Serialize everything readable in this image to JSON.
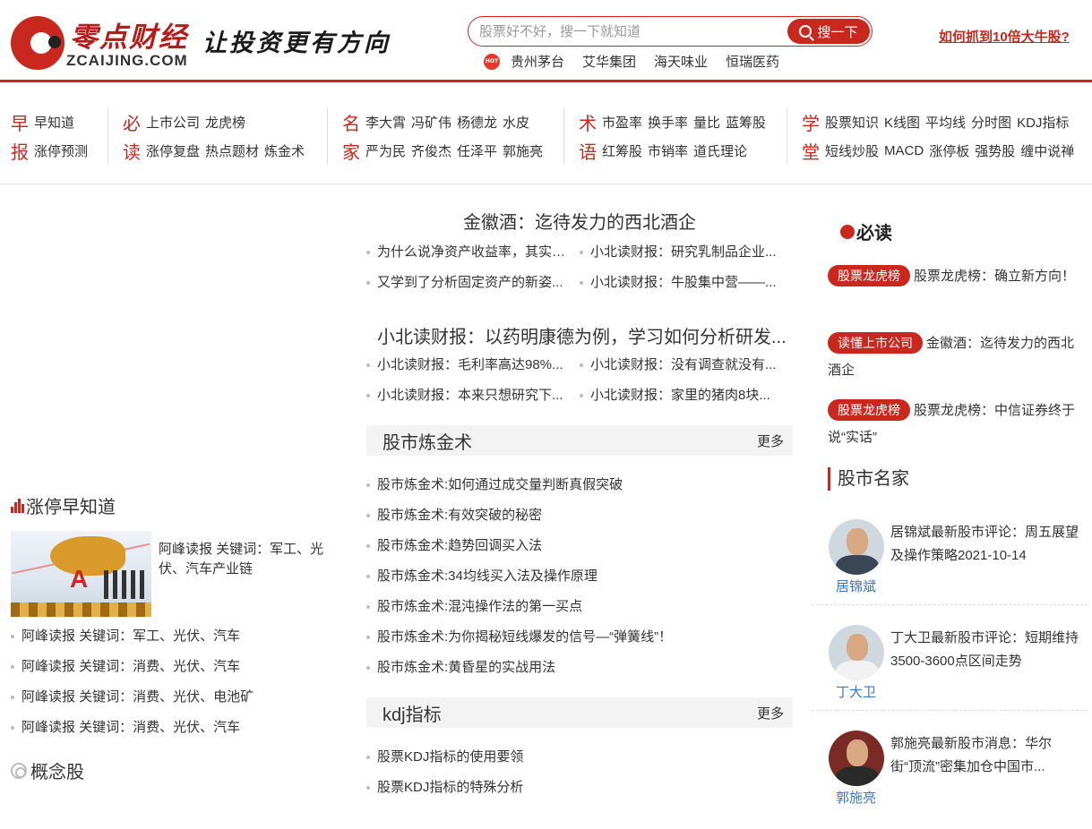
{
  "header": {
    "logo_cn": "零点财经",
    "logo_en": "ZCAIJING.COM",
    "slogan": "让投资更有方向",
    "search_placeholder": "股票好不好，搜一下就知道",
    "search_button": "搜一下",
    "hot_badge": "HOT",
    "hot_links": [
      "贵州茅台",
      "艾华集团",
      "海天味业",
      "恒瑞医药"
    ],
    "promo_link": "如何抓到10倍大牛股?"
  },
  "nav": [
    {
      "chars": [
        "早",
        "报"
      ],
      "rows": [
        [
          "早知道"
        ],
        [
          "涨停预测"
        ]
      ]
    },
    {
      "chars": [
        "必",
        "读"
      ],
      "rows": [
        [
          "上市公司",
          "龙虎榜"
        ],
        [
          "涨停复盘",
          "热点题材",
          "炼金术"
        ]
      ]
    },
    {
      "chars": [
        "名",
        "家"
      ],
      "rows": [
        [
          "李大霄",
          "冯矿伟",
          "杨德龙",
          "水皮"
        ],
        [
          "严为民",
          "齐俊杰",
          "任泽平",
          "郭施亮"
        ]
      ]
    },
    {
      "chars": [
        "术",
        "语"
      ],
      "rows": [
        [
          "市盈率",
          "换手率",
          "量比",
          "蓝筹股"
        ],
        [
          "红筹股",
          "市销率",
          "道氏理论"
        ]
      ]
    },
    {
      "chars": [
        "学",
        "堂"
      ],
      "rows": [
        [
          "股票知识",
          "K线图",
          "平均线",
          "分时图",
          "KDJ指标"
        ],
        [
          "短线炒股",
          "MACD",
          "涨停板",
          "强势股",
          "缠中说禅"
        ]
      ]
    }
  ],
  "left": {
    "limit_title": "涨停早知道",
    "feature_text": "阿峰读报 关键词：军工、光伏、汽车产业链",
    "list": [
      "阿峰读报 关键词：军工、光伏、汽车",
      "阿峰读报 关键词：消费、光伏、汽车",
      "阿峰读报 关键词：消费、光伏、电池矿",
      "阿峰读报 关键词：消费、光伏、汽车"
    ],
    "concept_title": "概念股"
  },
  "middle": {
    "headline1": "金徽酒：迄待发力的西北酒企",
    "group1": [
      [
        "为什么说净资产收益率，其实是...",
        "小北读财报：研究乳制品企业..."
      ],
      [
        "又学到了分析固定资产的新姿...",
        "小北读财报：牛股集中营——..."
      ]
    ],
    "headline2": "小北读财报：以药明康德为例，学习如何分析研发...",
    "group2": [
      [
        "小北读财报：毛利率高达98%...",
        "小北读财报：没有调查就没有..."
      ],
      [
        "小北读财报：本来只想研究下...",
        "小北读财报：家里的猪肉8块..."
      ]
    ],
    "panel1": {
      "title": "股市炼金术",
      "more": "更多",
      "items": [
        "股市炼金术:如何通过成交量判断真假突破",
        "股市炼金术:有效突破的秘密",
        "股市炼金术:趋势回调买入法",
        "股市炼金术:34均线买入法及操作原理",
        "股市炼金术:混沌操作法的第一买点",
        "股市炼金术:为你揭秘短线爆发的信号—“弹簧线”！",
        "股市炼金术:黄昏星的实战用法"
      ]
    },
    "panel2": {
      "title": "kdj指标",
      "more": "更多",
      "items": [
        "股票KDJ指标的使用要领",
        "股票KDJ指标的特殊分析"
      ]
    }
  },
  "right": {
    "must_title": "必读",
    "must_items": [
      {
        "tag": "股票龙虎榜",
        "text": "股票龙虎榜：确立新方向！"
      },
      {
        "tag": "读懂上市公司",
        "text": "金徽酒：迄待发力的西北酒企"
      },
      {
        "tag": "股票龙虎榜",
        "text": "股票龙虎榜：中信证券终于说“实话”"
      }
    ],
    "experts_title": "股市名家",
    "experts": [
      {
        "name": "居锦斌",
        "text": "居锦斌最新股市评论：周五展望及操作策略2021-10-14"
      },
      {
        "name": "丁大卫",
        "text": "丁大卫最新股市评论：短期维持3500-3600点区间走势"
      },
      {
        "name": "郭施亮",
        "text": "郭施亮最新股市消息：华尔街“顶流”密集加仓中国市..."
      }
    ]
  },
  "colors": {
    "brand": "#c8281e",
    "expert_name": "#3778c7"
  }
}
